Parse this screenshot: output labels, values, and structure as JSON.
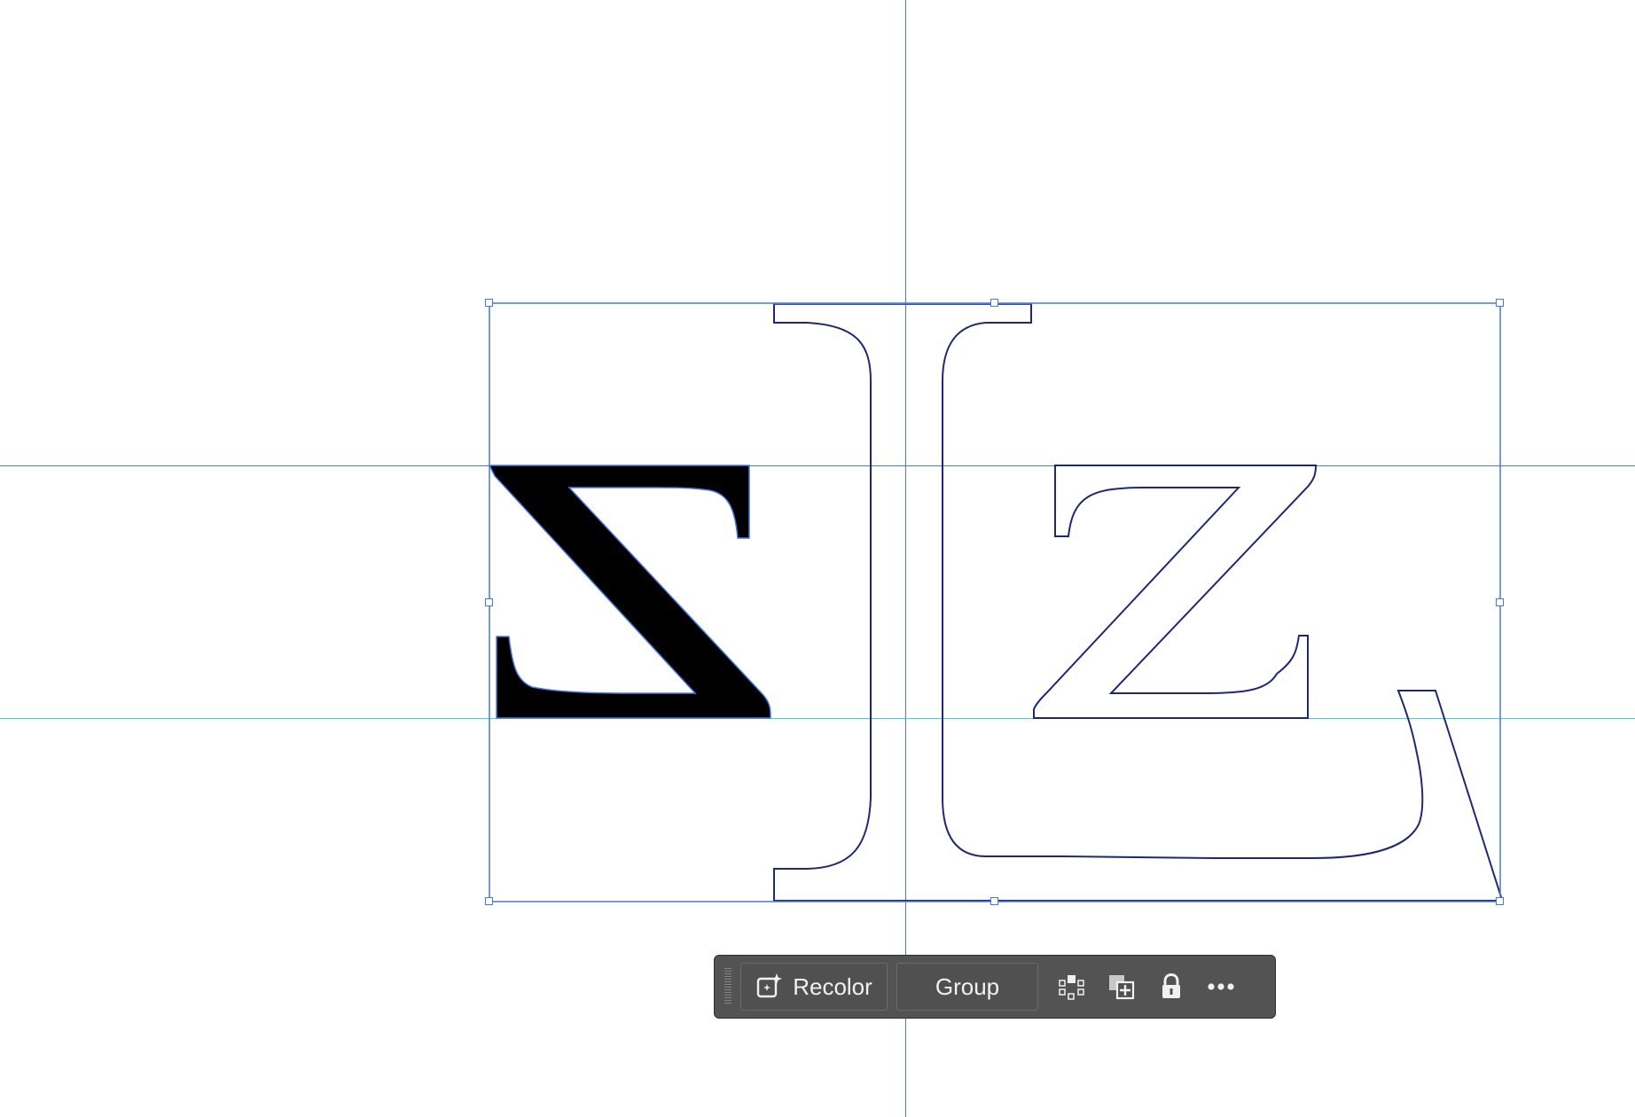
{
  "canvas": {
    "glyphs": [
      "Σ",
      "I",
      "L",
      "Z"
    ]
  },
  "taskbar": {
    "recolor_label": "Recolor",
    "group_label": "Group",
    "icons": [
      "isolate-icon",
      "arrange-icon",
      "lock-icon",
      "more-icon"
    ]
  },
  "colors": {
    "guide": "#4a77e8",
    "baseline": "#3fd0f0",
    "outline": "#1f2a6e",
    "taskbar_bg": "#535353"
  }
}
